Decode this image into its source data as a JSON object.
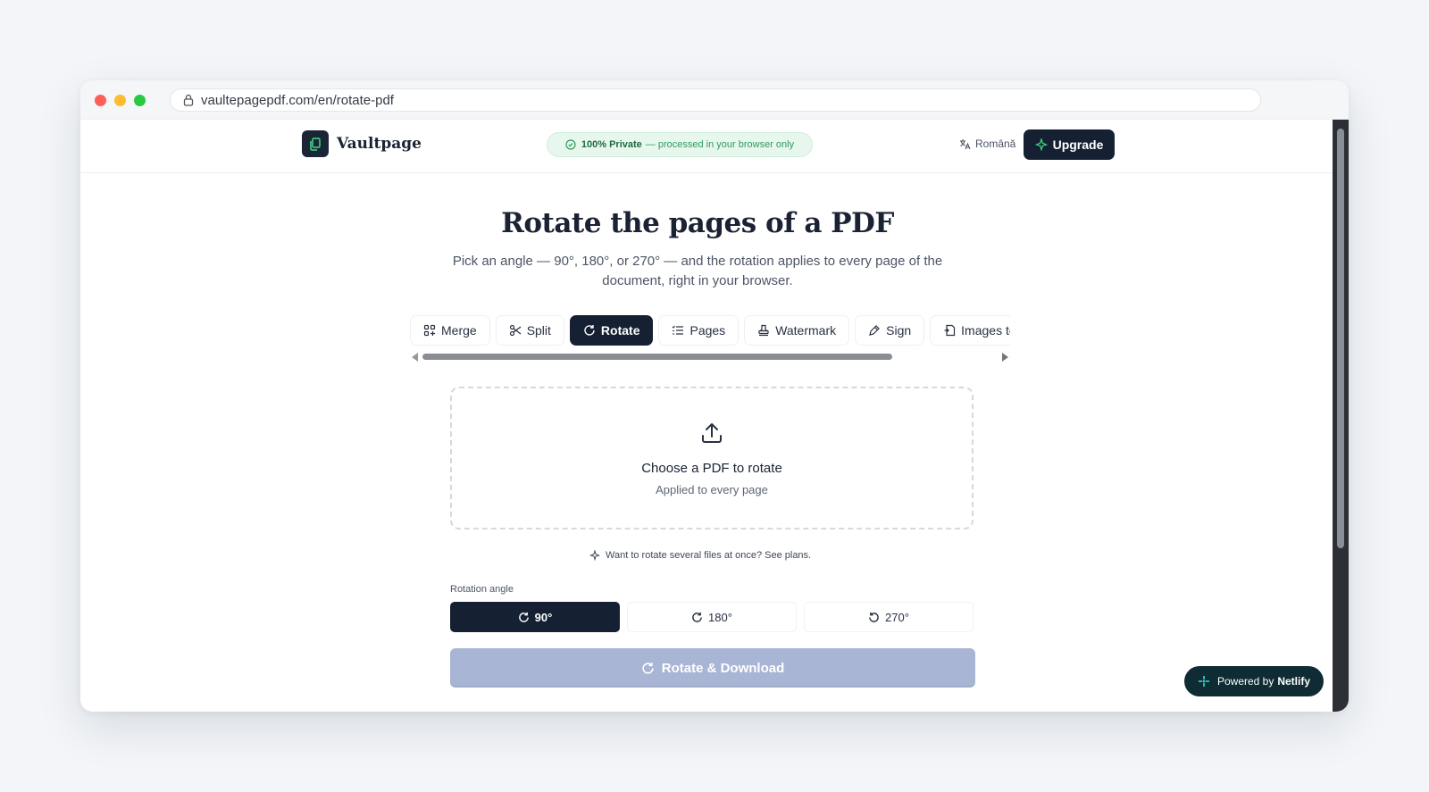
{
  "browser": {
    "url": "vaultepagepdf.com/en/rotate-pdf"
  },
  "header": {
    "brand": "Vaultpage",
    "privacy_strong": "100% Private",
    "privacy_text": "— processed in your browser only",
    "language": "Română",
    "upgrade": "Upgrade"
  },
  "hero": {
    "title": "Rotate the pages of a PDF",
    "subtitle": "Pick an angle — 90°, 180°, or 270° — and the rotation applies to every page of the document, right in your browser."
  },
  "tools": [
    {
      "label": "Merge",
      "icon": "merge-icon",
      "active": false
    },
    {
      "label": "Split",
      "icon": "scissors-icon",
      "active": false
    },
    {
      "label": "Rotate",
      "icon": "rotate-icon",
      "active": true
    },
    {
      "label": "Pages",
      "icon": "list-icon",
      "active": false
    },
    {
      "label": "Watermark",
      "icon": "stamp-icon",
      "active": false
    },
    {
      "label": "Sign",
      "icon": "pen-icon",
      "active": false
    },
    {
      "label": "Images to PDF",
      "icon": "image-icon",
      "active": false
    }
  ],
  "upload": {
    "title": "Choose a PDF to rotate",
    "subtitle": "Applied to every page"
  },
  "plans_hint": "Want to rotate several files at once? See plans.",
  "rotation": {
    "label": "Rotation angle",
    "options": [
      "90°",
      "180°",
      "270°"
    ],
    "selected": "90°"
  },
  "action": {
    "label": "Rotate & Download"
  },
  "badge": {
    "prefix": "Powered by",
    "name": "Netlify"
  },
  "colors": {
    "primary": "#152132",
    "privacy_green": "#2f9a5c",
    "action_disabled": "#a9b5d4",
    "netlify_bg": "#0f2b33"
  }
}
